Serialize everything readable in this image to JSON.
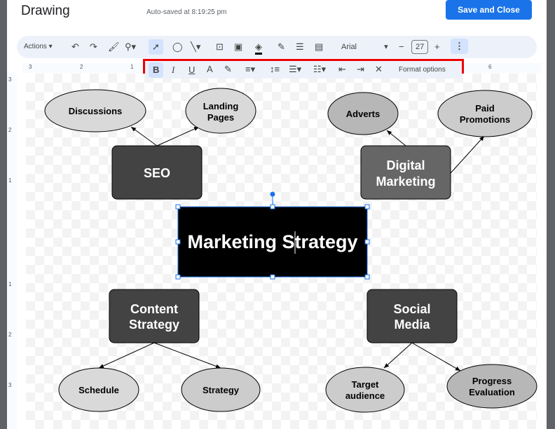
{
  "header": {
    "title": "Drawing",
    "autosave": "Auto-saved at 8:19:25 pm",
    "save_close": "Save and Close"
  },
  "toolbar": {
    "actions": "Actions",
    "font": "Arial",
    "font_size": "27",
    "minus": "−",
    "plus": "+"
  },
  "format_toolbar": {
    "format_options": "Format options",
    "bold": "B",
    "italic": "I",
    "underline": "U",
    "text_color": "A"
  },
  "ruler": {
    "top": [
      "3",
      "2",
      "1",
      "6"
    ],
    "left": [
      "3",
      "2",
      "1",
      "1",
      "2",
      "3"
    ]
  },
  "diagram": {
    "center": "Marketing Strategy",
    "seo": "SEO",
    "discussions": "Discussions",
    "landing": [
      "Landing",
      "Pages"
    ],
    "digital": [
      "Digital",
      "Marketing"
    ],
    "adverts": "Adverts",
    "paid": [
      "Paid",
      "Promotions"
    ],
    "content": [
      "Content",
      "Strategy"
    ],
    "schedule": "Schedule",
    "strategy": "Strategy",
    "social": [
      "Social",
      "Media"
    ],
    "target": [
      "Target",
      "audience"
    ],
    "progress": [
      "Progress",
      "Evaluation"
    ]
  },
  "colors": {
    "accent": "#1a73e8",
    "highlight": "#e00000"
  }
}
